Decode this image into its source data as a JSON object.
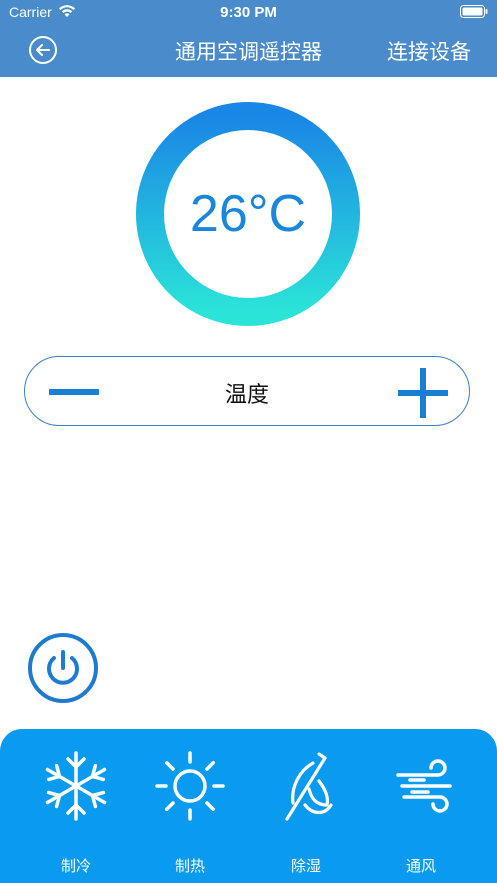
{
  "status_bar": {
    "carrier": "Carrier",
    "time": "9:30 PM"
  },
  "nav": {
    "title": "通用空调遥控器",
    "connect_label": "连接设备",
    "back_icon": "back-arrow-icon"
  },
  "temperature": {
    "value": "26°C",
    "label": "温度",
    "ring_colors": [
      "#1a86dc",
      "#2be0dc"
    ]
  },
  "modes": [
    {
      "label": "制冷",
      "icon": "snowflake-icon"
    },
    {
      "label": "制热",
      "icon": "sun-icon"
    },
    {
      "label": "除湿",
      "icon": "dehumidify-icon"
    },
    {
      "label": "通风",
      "icon": "wind-icon"
    }
  ],
  "colors": {
    "nav_bar": "#4a8ccb",
    "accent": "#1a86dc",
    "mode_panel": "#0a9bf0"
  }
}
